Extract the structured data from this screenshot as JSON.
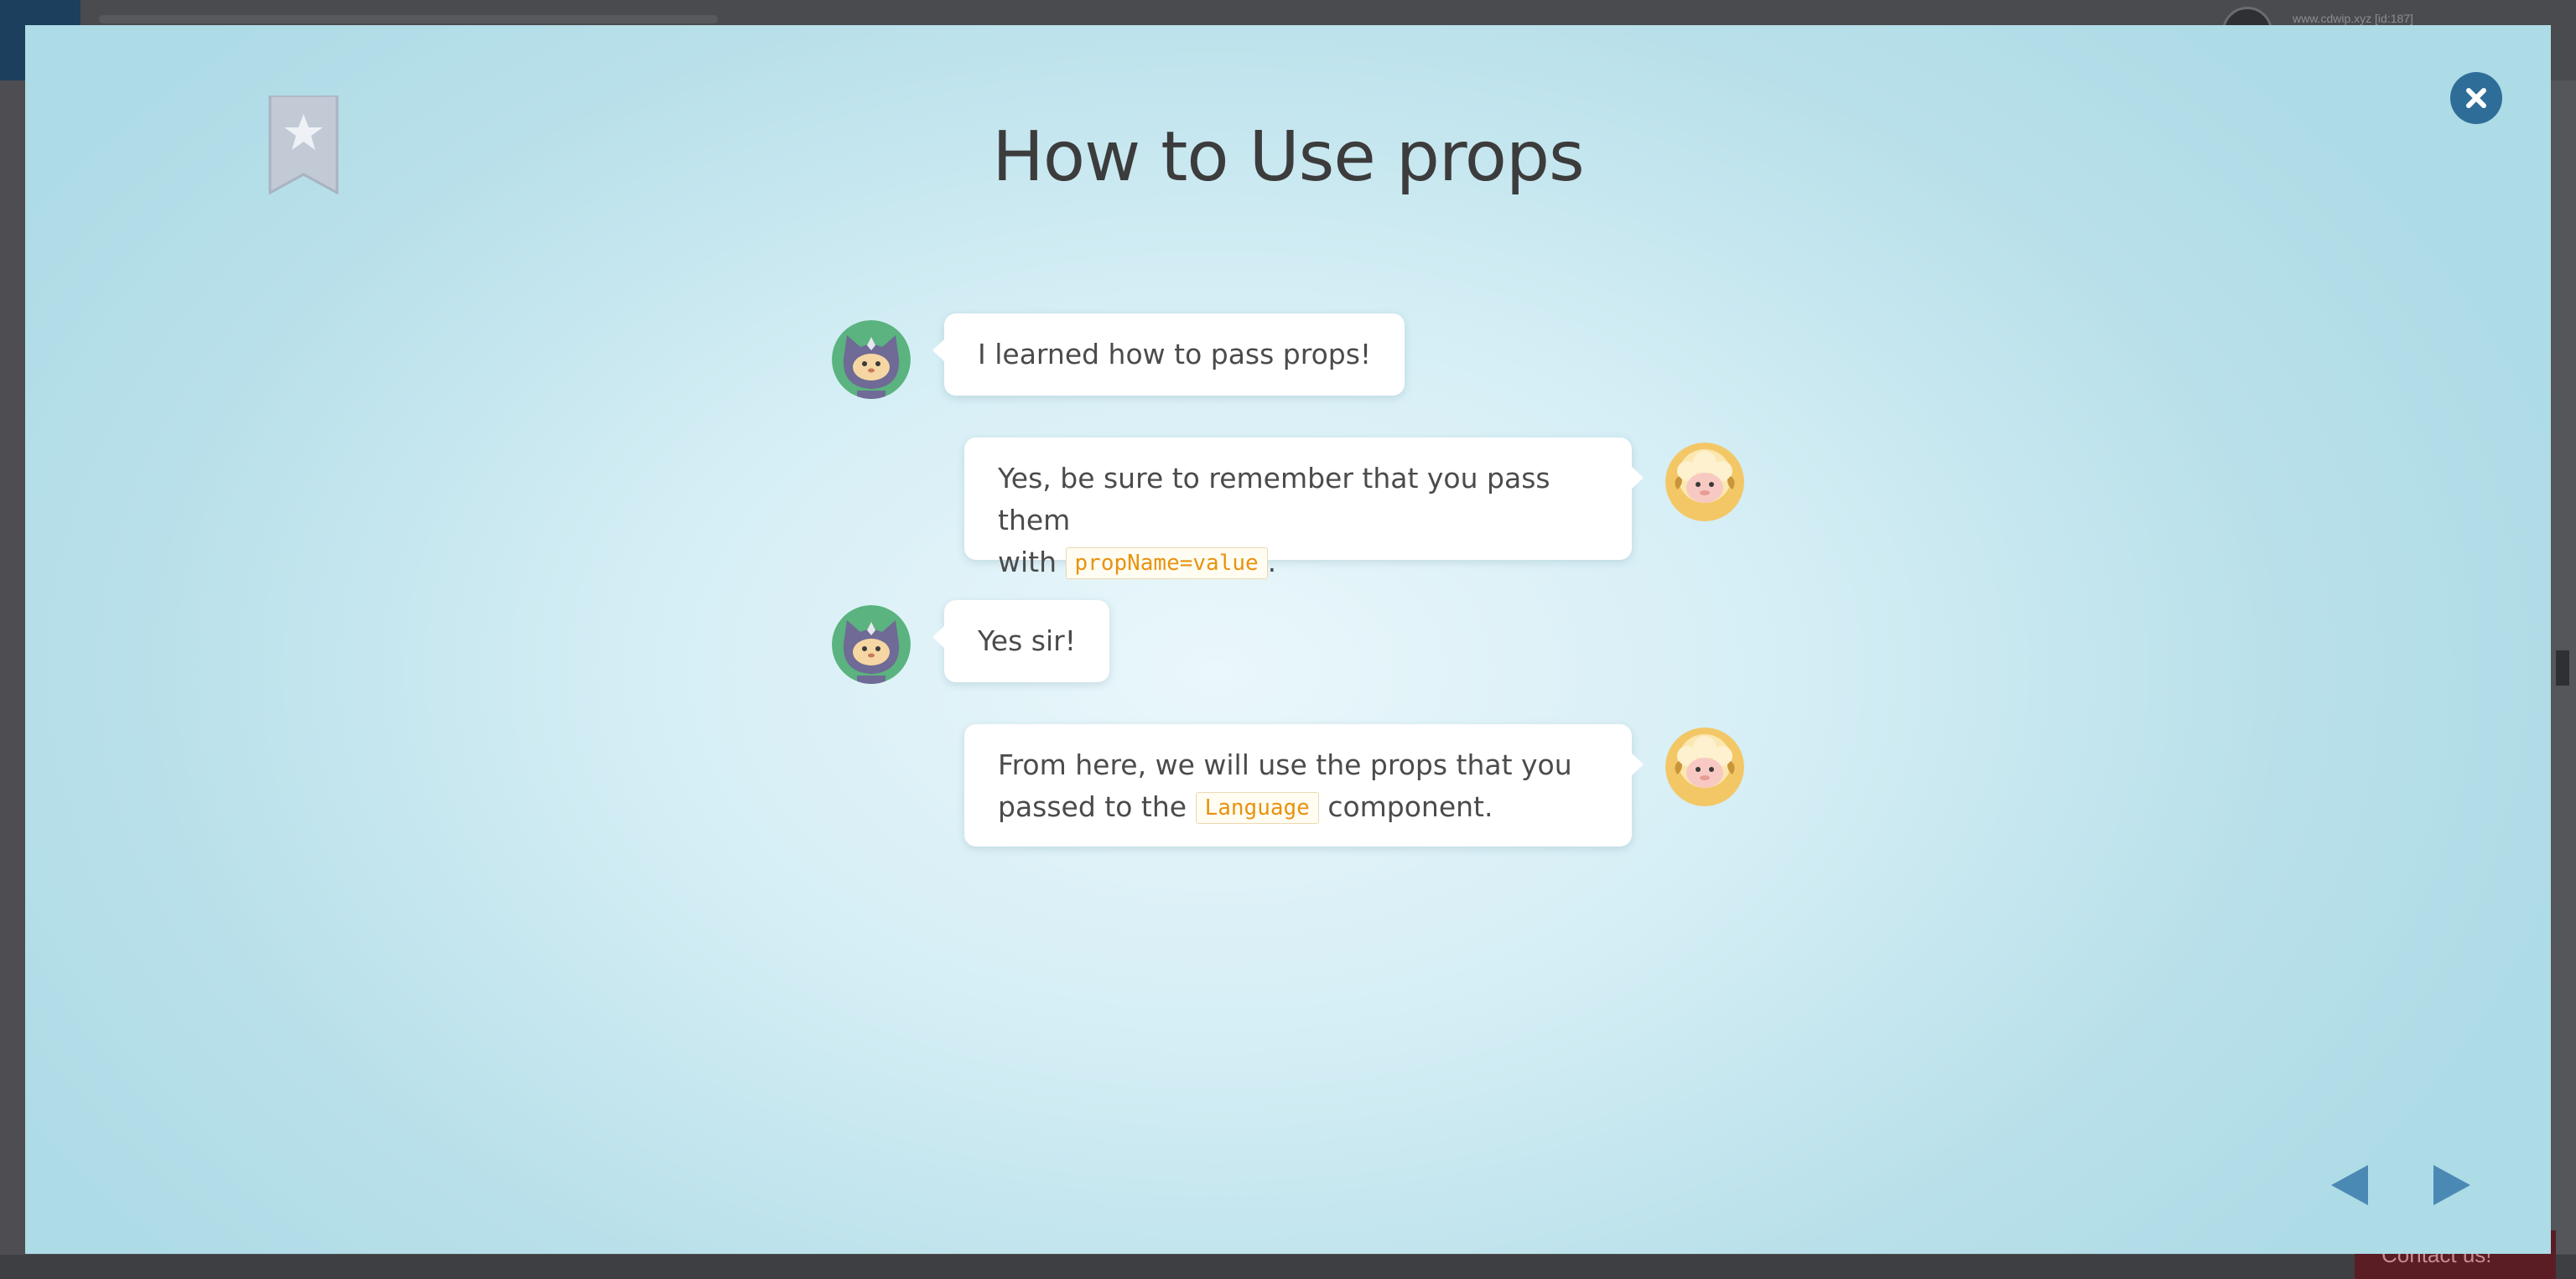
{
  "background": {
    "meta_text": "www.cdwip.xyz [id:187]",
    "contact_label": "Contact us!"
  },
  "modal": {
    "title": "How to Use props",
    "bookmark_icon": "bookmark-star-icon",
    "close_icon": "close-icon",
    "messages": [
      {
        "speaker": "ninja-cat",
        "side": "left",
        "text": "I learned how to pass props!"
      },
      {
        "speaker": "sheep",
        "side": "right",
        "before_line1": "Yes, be sure to remember that you pass them",
        "before_line2": "with",
        "code": "propName=value",
        "after": "."
      },
      {
        "speaker": "ninja-cat",
        "side": "left",
        "text": "Yes sir!"
      },
      {
        "speaker": "sheep",
        "side": "right",
        "before_line1": "From here, we will use the props that you",
        "before_line2": "passed to the",
        "code": "Language",
        "after": "component."
      }
    ],
    "nav": {
      "prev_icon": "triangle-left-icon",
      "next_icon": "triangle-right-icon"
    }
  },
  "colors": {
    "close_button": "#2e6d98",
    "nav_arrows": "#4b89b5",
    "code_text": "#e8930f",
    "cat_background": "#5bb37f",
    "sheep_background": "#f3c766"
  }
}
